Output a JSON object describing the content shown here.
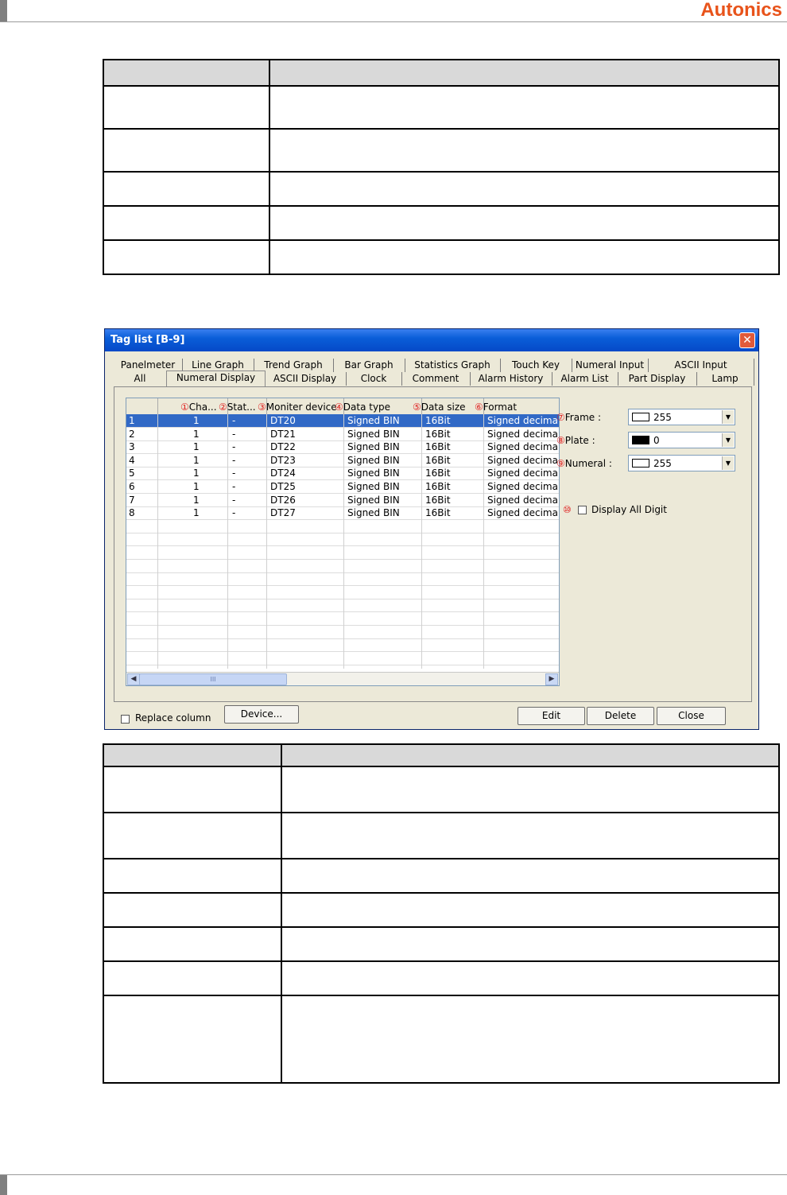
{
  "brand": "Autonics",
  "dialog": {
    "title": "Tag list [B-9]",
    "close_symbol": "✕",
    "tabs_row1": [
      "Panelmeter",
      "Line Graph",
      "Trend Graph",
      "Bar Graph",
      "Statistics Graph",
      "Touch Key",
      "Numeral Input",
      "ASCII Input"
    ],
    "tabs_row2": [
      "All",
      "Numeral Display",
      "ASCII Display",
      "Clock",
      "Comment",
      "Alarm History",
      "Alarm List",
      "Part Display",
      "Lamp"
    ],
    "active_tab": "Numeral Display",
    "columns": [
      {
        "mark": "①",
        "label": "Cha..."
      },
      {
        "mark": "②",
        "label": "Stat..."
      },
      {
        "mark": "③",
        "label": "Moniter device"
      },
      {
        "mark": "④",
        "label": "Data type"
      },
      {
        "mark": "⑤",
        "label": "Data size"
      },
      {
        "mark": "⑥",
        "label": "Format"
      }
    ],
    "rows": [
      [
        "1",
        "1",
        "-",
        "DT20",
        "Signed BIN",
        "16Bit",
        "Signed decimal"
      ],
      [
        "2",
        "1",
        "-",
        "DT21",
        "Signed BIN",
        "16Bit",
        "Signed decimal"
      ],
      [
        "3",
        "1",
        "-",
        "DT22",
        "Signed BIN",
        "16Bit",
        "Signed decimal"
      ],
      [
        "4",
        "1",
        "-",
        "DT23",
        "Signed BIN",
        "16Bit",
        "Signed decimal"
      ],
      [
        "5",
        "1",
        "-",
        "DT24",
        "Signed BIN",
        "16Bit",
        "Signed decimal"
      ],
      [
        "6",
        "1",
        "-",
        "DT25",
        "Signed BIN",
        "16Bit",
        "Signed decimal"
      ],
      [
        "7",
        "1",
        "-",
        "DT26",
        "Signed BIN",
        "16Bit",
        "Signed decimal"
      ],
      [
        "8",
        "1",
        "-",
        "DT27",
        "Signed BIN",
        "16Bit",
        "Signed decimal"
      ]
    ],
    "selected_row": 1,
    "scroll_grip": "III",
    "props": {
      "frame": {
        "mark": "⑦",
        "label": "Frame :",
        "value": "255",
        "color": "#ffffff"
      },
      "plate": {
        "mark": "⑧",
        "label": "Plate :",
        "value": "0",
        "color": "#000000"
      },
      "numeral": {
        "mark": "⑨",
        "label": "Numeral :",
        "value": "255",
        "color": "#ffffff"
      }
    },
    "display_all": {
      "mark": "⑩",
      "label": "Display All Digit"
    },
    "replace_column": "Replace column",
    "buttons": {
      "device": "Device...",
      "edit": "Edit",
      "delete": "Delete",
      "close": "Close"
    }
  }
}
